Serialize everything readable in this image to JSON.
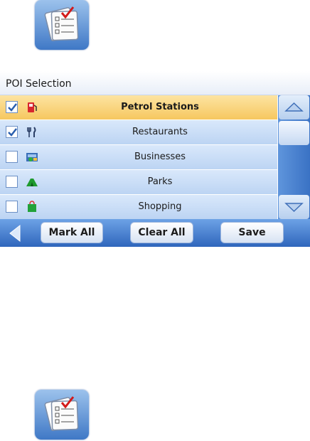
{
  "screen": {
    "title": "POI Selection",
    "items": [
      {
        "label": "Petrol Stations",
        "checked": true,
        "icon": "fuel-pump-icon",
        "selected": true
      },
      {
        "label": "Restaurants",
        "checked": true,
        "icon": "fork-knife-icon",
        "selected": false
      },
      {
        "label": "Businesses",
        "checked": false,
        "icon": "business-icon",
        "selected": false
      },
      {
        "label": "Parks",
        "checked": false,
        "icon": "park-tent-icon",
        "selected": false
      },
      {
        "label": "Shopping",
        "checked": false,
        "icon": "shopping-bag-icon",
        "selected": false
      }
    ],
    "toolbar": {
      "back_icon": "back-arrow-icon",
      "mark_all_label": "Mark All",
      "clear_all_label": "Clear All",
      "save_label": "Save"
    }
  },
  "icons": {
    "app_icon": "checklist-icon",
    "scroll_up": "scroll-up-icon",
    "scroll_down": "scroll-down-icon"
  },
  "colors": {
    "selected_row": "#f6c75f",
    "row": "#c7dcf6",
    "toolbar": "#3a72c4",
    "check": "#2a5fae"
  }
}
